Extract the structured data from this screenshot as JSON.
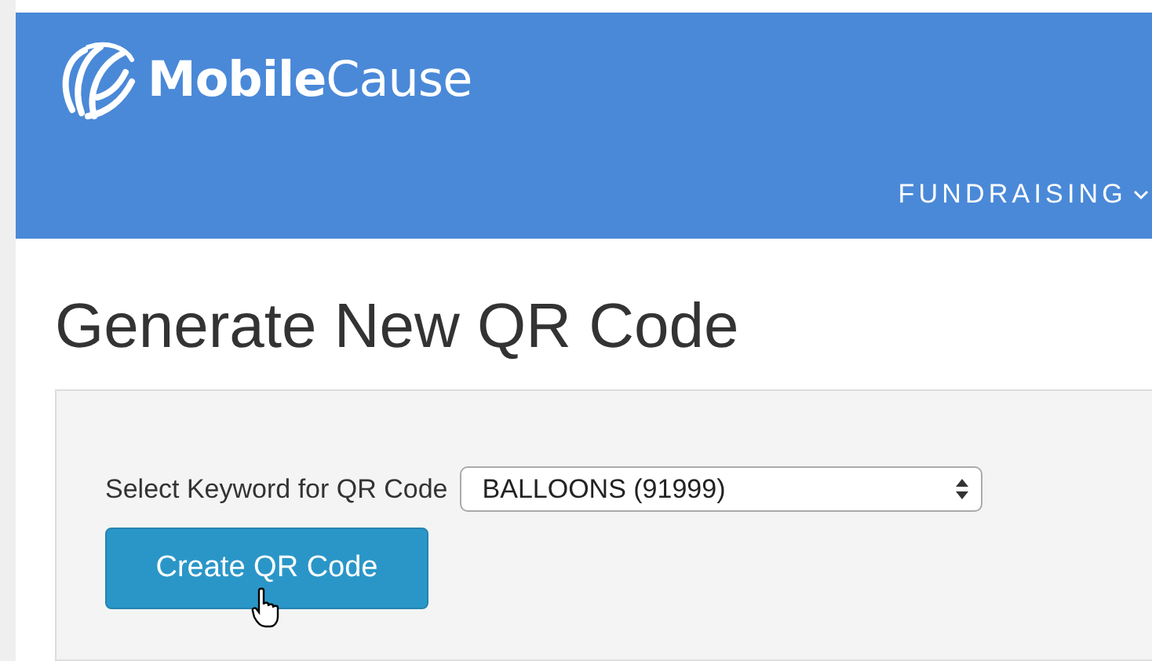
{
  "header": {
    "logo_text": "**Mobile**Cause",
    "nav": [
      {
        "label": "FUNDRAISING"
      }
    ]
  },
  "page_title": "Generate New QR Code",
  "form": {
    "label": "Select Keyword for QR Code",
    "select_value": "BALLOONS (91999)",
    "button": "Create QR Code"
  }
}
